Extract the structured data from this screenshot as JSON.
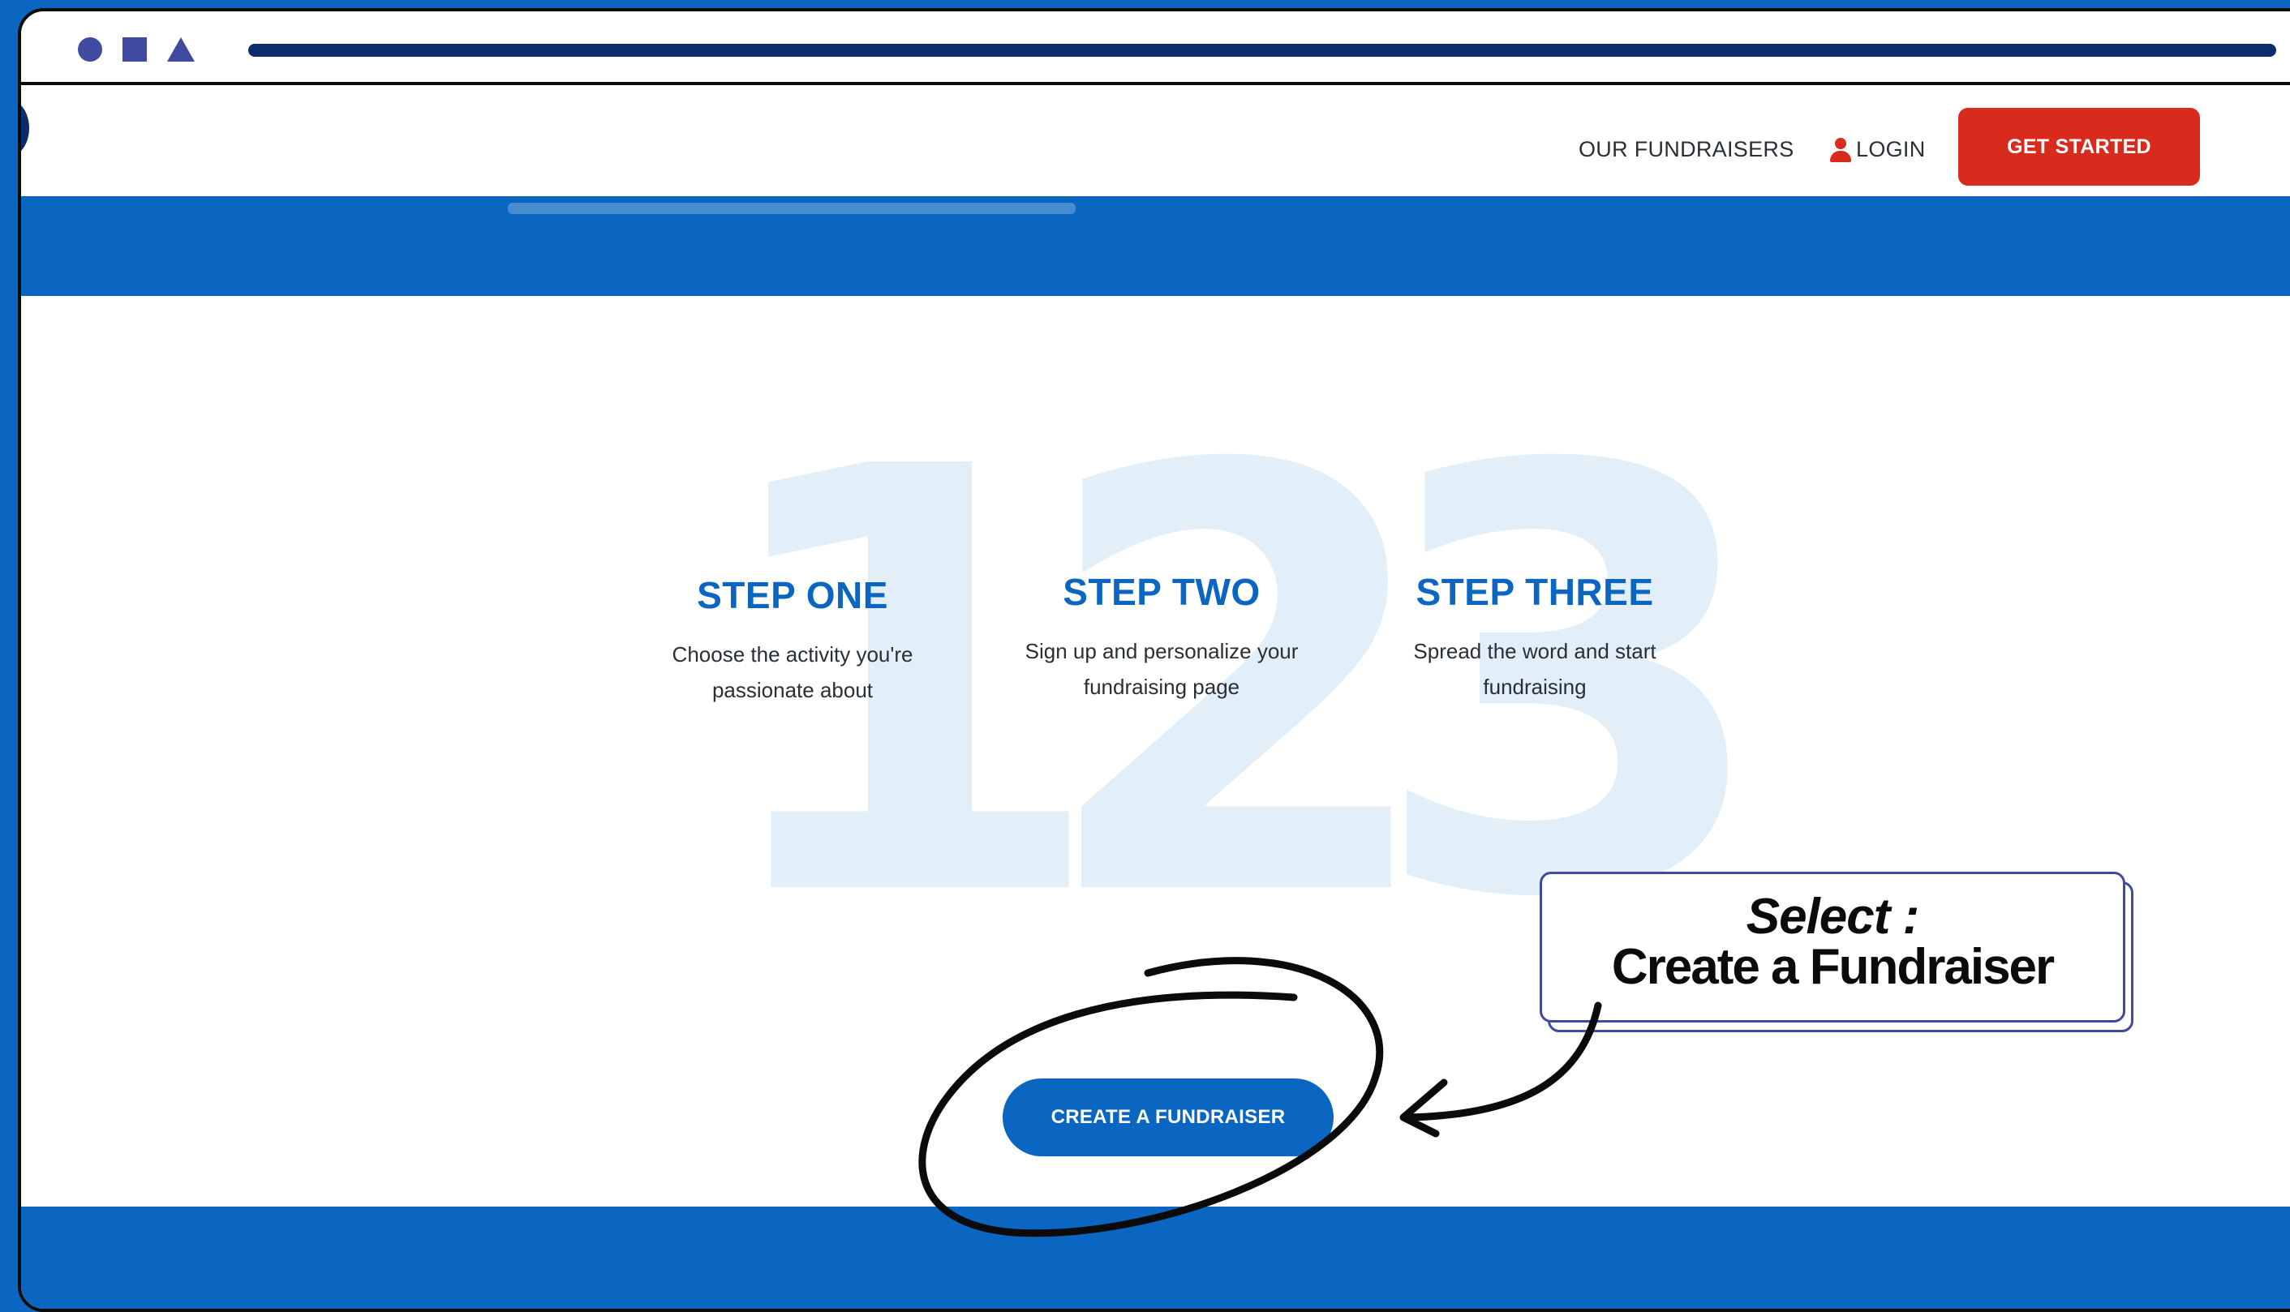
{
  "nav": {
    "our_fundraisers": "OUR FUNDRAISERS",
    "login": "LOGIN",
    "get_started": "GET STARTED"
  },
  "steps": [
    {
      "number": "1",
      "title": "STEP ONE",
      "line1": "Choose the activity you're",
      "line2": "passionate about"
    },
    {
      "number": "2",
      "title": "STEP TWO",
      "line1": "Sign up and personalize your",
      "line2": "fundraising page"
    },
    {
      "number": "3",
      "title": "STEP THREE",
      "line1": "Spread the word and start",
      "line2": "fundraising"
    }
  ],
  "cta": {
    "label": "CREATE A FUNDRAISER"
  },
  "callout": {
    "line1": "Select :",
    "line2": "Create a Fundraiser"
  },
  "colors": {
    "brand_blue": "#0a66c0",
    "accent_red": "#d92a1e",
    "outline_purple": "#3f4aa0"
  },
  "icons": [
    "circle-icon",
    "square-icon",
    "triangle-icon",
    "user-icon"
  ]
}
